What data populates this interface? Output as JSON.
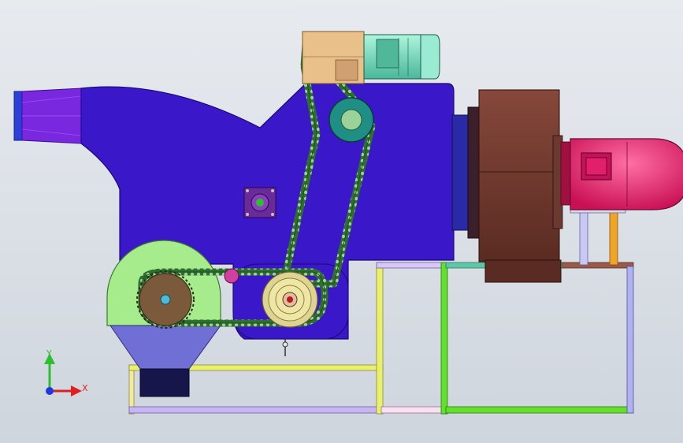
{
  "view": {
    "background_top": "#e7ebf0",
    "background_bottom": "#cfd5dd"
  },
  "triad": {
    "x_label": "X",
    "y_label": "Y",
    "x_color": "#e02020",
    "y_color": "#2cc02c",
    "z_color": "#2038e0"
  },
  "colors": {
    "housing": "#3a17c9",
    "inlet": "#6a22d8",
    "flywheel": "#a6ec8c",
    "hopper": "#6f6fd6",
    "gearbox": "#e9c08a",
    "motor_small": "#6fe0c0",
    "fan": "#7b4034",
    "motor_large": "#f0246e",
    "frame_yellow": "#e9f06a",
    "frame_green": "#62e02c",
    "frame_lavender": "#c7b6f2",
    "chain": "#3f9a3f",
    "sprocket_brown": "#7a5a3a",
    "sprocket_cream": "#efe6a6",
    "sprocket_teal": "#1f8f86",
    "sprocket_navy": "#1b4c8c"
  },
  "components": [
    "inlet-duct",
    "main-housing",
    "flywheel-guard",
    "discharge-hopper",
    "gear-reducer",
    "small-drive-motor",
    "fan-housing",
    "main-motor",
    "support-frame",
    "chain-drive-upper",
    "chain-drive-lower",
    "bearing-block"
  ]
}
